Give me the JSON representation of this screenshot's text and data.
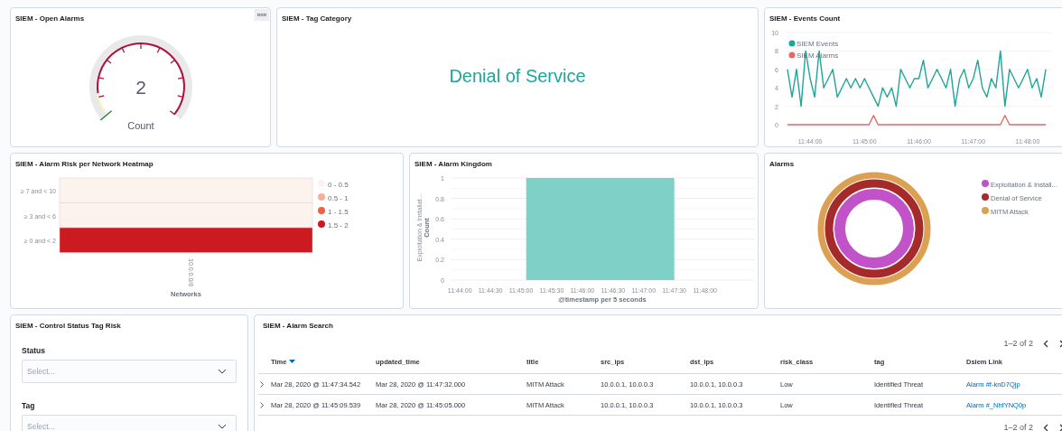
{
  "open_alarms": {
    "title": "SIEM - Open Alarms",
    "value": "2",
    "label": "Count"
  },
  "tag_category": {
    "title": "SIEM - Tag Category",
    "value": "Denial of Service"
  },
  "events_count": {
    "title": "SIEM - Events Count",
    "chart_data": {
      "type": "line",
      "grid": true,
      "legend": "top-left",
      "categories": [
        null,
        null,
        null,
        null,
        null,
        "11:44:00",
        null,
        null,
        null,
        null,
        null,
        null,
        null,
        null,
        null,
        null,
        null,
        "11:45:00",
        null,
        null,
        null,
        null,
        null,
        null,
        null,
        null,
        null,
        null,
        null,
        "11:46:00",
        null,
        null,
        null,
        null,
        null,
        null,
        null,
        null,
        null,
        null,
        null,
        "11:47:00",
        null,
        null,
        null,
        null,
        null,
        null,
        null,
        null,
        null,
        null,
        null,
        "11:48:00",
        null,
        null,
        null,
        null
      ],
      "ylim": [
        0,
        10
      ],
      "yticks": [
        0,
        2,
        4,
        6,
        8,
        10
      ],
      "series": [
        {
          "name": "SIEM Events",
          "color": "#1ea69a",
          "values": [
            6,
            3,
            6,
            2,
            8,
            5,
            3,
            8,
            4,
            5,
            6,
            3,
            4,
            5,
            4,
            5,
            4,
            5,
            4,
            3,
            2,
            4,
            3,
            4,
            2,
            6,
            5,
            4,
            5,
            5,
            7,
            4,
            5,
            6,
            5,
            4,
            6,
            2,
            5,
            6,
            4,
            5,
            7,
            4,
            3,
            5,
            4,
            8,
            2,
            6,
            5,
            4,
            5,
            6,
            4,
            5,
            3,
            6
          ]
        },
        {
          "name": "SIEM Alarms",
          "color": "#e06b6b",
          "values": [
            0,
            0,
            0,
            0,
            0,
            0,
            0,
            0,
            0,
            0,
            0,
            0,
            0,
            0,
            0,
            0,
            0,
            0,
            0,
            1,
            0,
            0,
            0,
            0,
            0,
            0,
            0,
            0,
            0,
            0,
            0,
            0,
            0,
            0,
            0,
            0,
            0,
            0,
            0,
            0,
            0,
            0,
            0,
            0,
            0,
            0,
            0,
            0,
            1,
            0,
            0,
            0,
            0,
            0,
            0,
            0,
            0,
            0
          ]
        }
      ]
    }
  },
  "heatmap": {
    "title": "SIEM - Alarm Risk per Network Heatmap",
    "rows": [
      {
        "label": "≥ 7 and < 10",
        "color": "#fdf3ee"
      },
      {
        "label": "≥ 3 and < 6",
        "color": "#fdf3ee"
      },
      {
        "label": "≥ 0 and < 2",
        "color": "#cb1a20"
      }
    ],
    "column": "10.0.0.0/8",
    "xlabel": "Networks",
    "legend": [
      {
        "label": "0 - 0.5",
        "color": "#fdf3ee"
      },
      {
        "label": "0.5 - 1",
        "color": "#f7b096"
      },
      {
        "label": "1 - 1.5",
        "color": "#f2613f"
      },
      {
        "label": "1.5 - 2",
        "color": "#cb1a20"
      }
    ]
  },
  "alarm_kingdom": {
    "title": "SIEM - Alarm Kingdom",
    "chart_data": {
      "type": "area",
      "grid": true,
      "xlabel": "@timestamp per 5 seconds",
      "ylabel": "Count",
      "ylim": [
        0,
        1
      ],
      "yticks": [
        0,
        0.2,
        0.4,
        0.6,
        0.8,
        1
      ],
      "categories": [
        null,
        "11:44:00",
        null,
        null,
        null,
        null,
        null,
        "11:44:30",
        null,
        null,
        null,
        null,
        null,
        "11:45:00",
        null,
        null,
        null,
        null,
        null,
        "11:45:30",
        null,
        null,
        null,
        null,
        null,
        "11:46:00",
        null,
        null,
        null,
        null,
        null,
        "11:46:30",
        null,
        null,
        null,
        null,
        null,
        "11:47:00",
        null,
        null,
        null,
        null,
        null,
        "11:47:30",
        null,
        null,
        null,
        null,
        null,
        "11:48:00",
        null,
        null,
        null,
        null,
        null,
        null,
        null,
        null,
        null
      ],
      "series": [
        {
          "name": "Exploitation & Installat...",
          "color": "#7fd0c6",
          "values": [
            null,
            null,
            null,
            null,
            null,
            null,
            null,
            null,
            null,
            null,
            null,
            null,
            null,
            null,
            1,
            1,
            1,
            1,
            1,
            1,
            1,
            1,
            1,
            1,
            1,
            1,
            1,
            1,
            1,
            1,
            1,
            1,
            1,
            1,
            1,
            1,
            1,
            1,
            1,
            1,
            1,
            1,
            1,
            1,
            null,
            null,
            null,
            null,
            null,
            null,
            null,
            null,
            null,
            null,
            null,
            null,
            null,
            null,
            null
          ]
        }
      ]
    }
  },
  "alarms": {
    "title": "Alarms",
    "legend": [
      {
        "label": "Exploitation & Install...",
        "color": "#c152c8"
      },
      {
        "label": "Denial of Service",
        "color": "#a52a2a"
      },
      {
        "label": "MITM Attack",
        "color": "#dba052"
      }
    ]
  },
  "control": {
    "title": "SIEM - Control Status Tag Risk",
    "fields": [
      {
        "label": "Status",
        "placeholder": "Select..."
      },
      {
        "label": "Tag",
        "placeholder": "Select..."
      }
    ]
  },
  "alarm_search": {
    "title": "SIEM - Alarm Search",
    "pagination": "1–2 of 2",
    "columns": [
      "Time",
      "updated_time",
      "title",
      "src_ips",
      "dst_ips",
      "risk_class",
      "tag",
      "Dsiem Link"
    ],
    "rows": [
      {
        "cells": [
          "Mar 28, 2020 @ 11:47:34.542",
          "Mar 28, 2020 @ 11:47:32.000",
          "MITM Attack",
          "10.0.0.1, 10.0.0.3",
          "10.0.0.1, 10.0.0.3",
          "Low",
          "Identified Threat"
        ],
        "link": "Alarm #f-knD7Qjp"
      },
      {
        "cells": [
          "Mar 28, 2020 @ 11:45:09.539",
          "Mar 28, 2020 @ 11:45:05.000",
          "MITM Attack",
          "10.0.0.1, 10.0.0.3",
          "10.0.0.1, 10.0.0.3",
          "Low",
          "Identified Threat"
        ],
        "link": "Alarm #_NhfYNQ0p"
      }
    ],
    "pagination_bottom": "1–2 of 2"
  }
}
